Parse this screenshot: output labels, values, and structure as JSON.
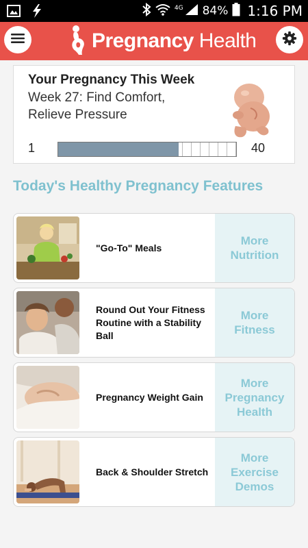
{
  "status_bar": {
    "network": "4G",
    "battery_pct": "84%",
    "time": "1:16 PM"
  },
  "header": {
    "title_bold": "Pregnancy",
    "title_light": "Health",
    "menu_icon": "hamburger-menu-icon",
    "settings_icon": "gear-icon",
    "accent_color": "#e8524a"
  },
  "week_card": {
    "heading": "Your Pregnancy This Week",
    "subtitle": "Week 27: Find Comfort, Relieve Pressure",
    "progress_start": "1",
    "progress_end": "40",
    "progress_fraction": 0.675
  },
  "features_title": "Today's Healthy Pregnancy Features",
  "features": [
    {
      "title": "\"Go-To\" Meals",
      "more": "More Nutrition"
    },
    {
      "title": "Round Out Your Fitness Routine with a Stability Ball",
      "more": "More Fitness"
    },
    {
      "title": "Pregnancy Weight Gain",
      "more": "More Pregnancy Health"
    },
    {
      "title": "Back & Shoulder Stretch",
      "more": "More Exercise Demos"
    }
  ]
}
